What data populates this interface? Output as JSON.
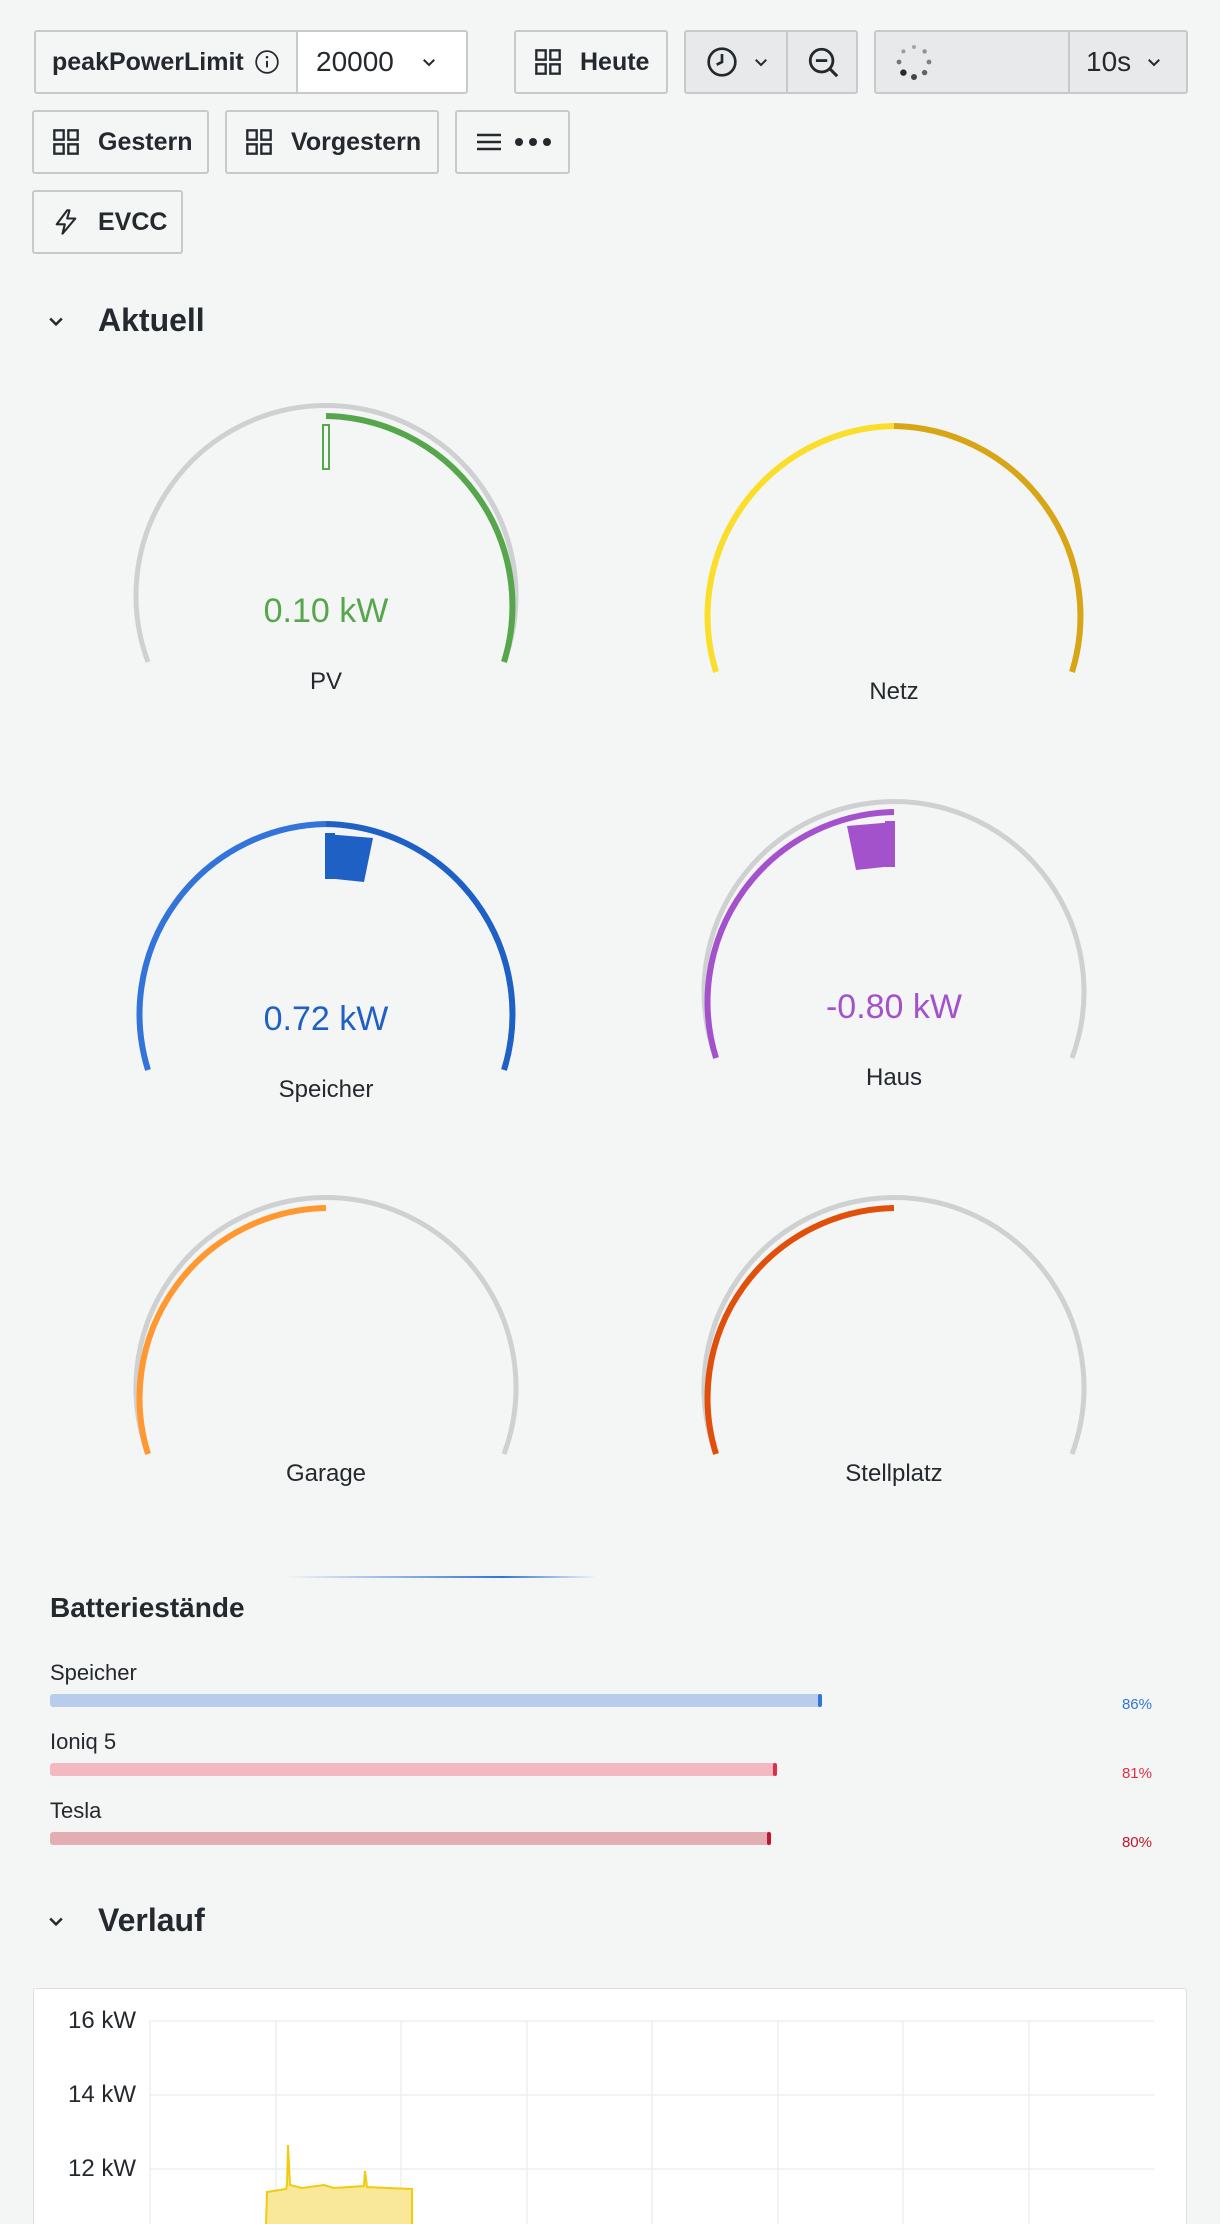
{
  "toolbar": {
    "variable_label": "peakPowerLimit",
    "variable_value": "20000",
    "dash_today": "Heute",
    "dash_yesterday": "Gestern",
    "dash_day_before": "Vorgestern",
    "dash_evcc": "EVCC",
    "refresh_interval": "10s"
  },
  "sections": {
    "current": "Aktuell",
    "history": "Verlauf"
  },
  "gauges": [
    {
      "label": "PV",
      "value": "0.10 kW",
      "color": "#56a64b"
    },
    {
      "label": "Netz",
      "value": "",
      "color": "#fade2a"
    },
    {
      "label": "Speicher",
      "value": "0.72 kW",
      "color": "#1f60c4"
    },
    {
      "label": "Haus",
      "value": "-0.80 kW",
      "color": "#a352cc"
    },
    {
      "label": "Garage",
      "value": "",
      "color": "#ff9830"
    },
    {
      "label": "Stellplatz",
      "value": "",
      "color": "#e0500b"
    }
  ],
  "batteries": {
    "title": "Batteriestände",
    "items": [
      {
        "name": "Speicher",
        "percent": "86%",
        "level": 0.86,
        "color": "#3274d9"
      },
      {
        "name": "Ioniq 5",
        "percent": "81%",
        "level": 0.81,
        "color": "#e02f44"
      },
      {
        "name": "Tesla",
        "percent": "80%",
        "level": 0.8,
        "color": "#c4162a"
      }
    ]
  },
  "history_chart": {
    "y_ticks": [
      "16 kW",
      "14 kW",
      "12 kW"
    ],
    "series_color": "#f2cc0c"
  }
}
